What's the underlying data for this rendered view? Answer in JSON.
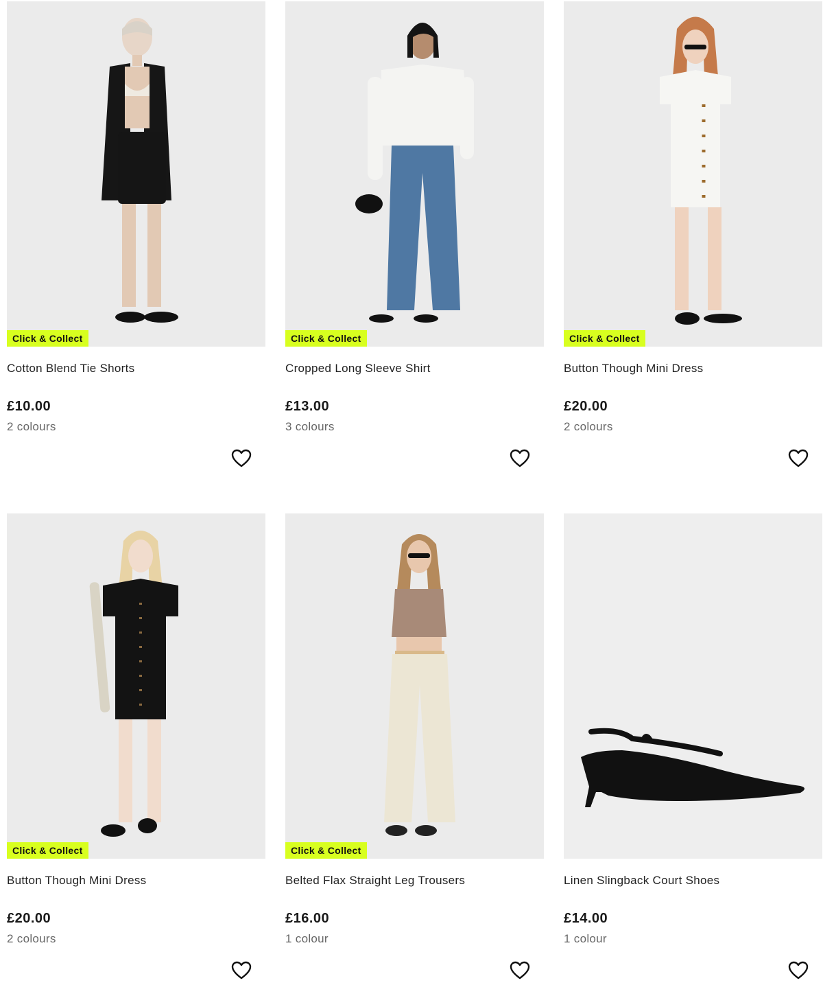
{
  "products": [
    {
      "title": "Cotton Blend Tie Shorts",
      "price": "£10.00",
      "colours": "2 colours",
      "badge": "Click & Collect"
    },
    {
      "title": "Cropped Long Sleeve Shirt",
      "price": "£13.00",
      "colours": "3 colours",
      "badge": "Click & Collect"
    },
    {
      "title": "Button Though Mini Dress",
      "price": "£20.00",
      "colours": "2 colours",
      "badge": "Click & Collect"
    },
    {
      "title": "Button Though Mini Dress",
      "price": "£20.00",
      "colours": "2 colours",
      "badge": "Click & Collect"
    },
    {
      "title": "Belted Flax Straight Leg Trousers",
      "price": "£16.00",
      "colours": "1 colour",
      "badge": "Click & Collect"
    },
    {
      "title": "Linen Slingback Court Shoes",
      "price": "£14.00",
      "colours": "1 colour",
      "badge": ""
    }
  ],
  "icons": {
    "wishlist": "heart-outline-icon"
  },
  "colors": {
    "badge_bg": "#d8ff1f",
    "image_bg": "#ebebeb",
    "text": "#1a1a1a",
    "subtle_text": "#666666"
  }
}
